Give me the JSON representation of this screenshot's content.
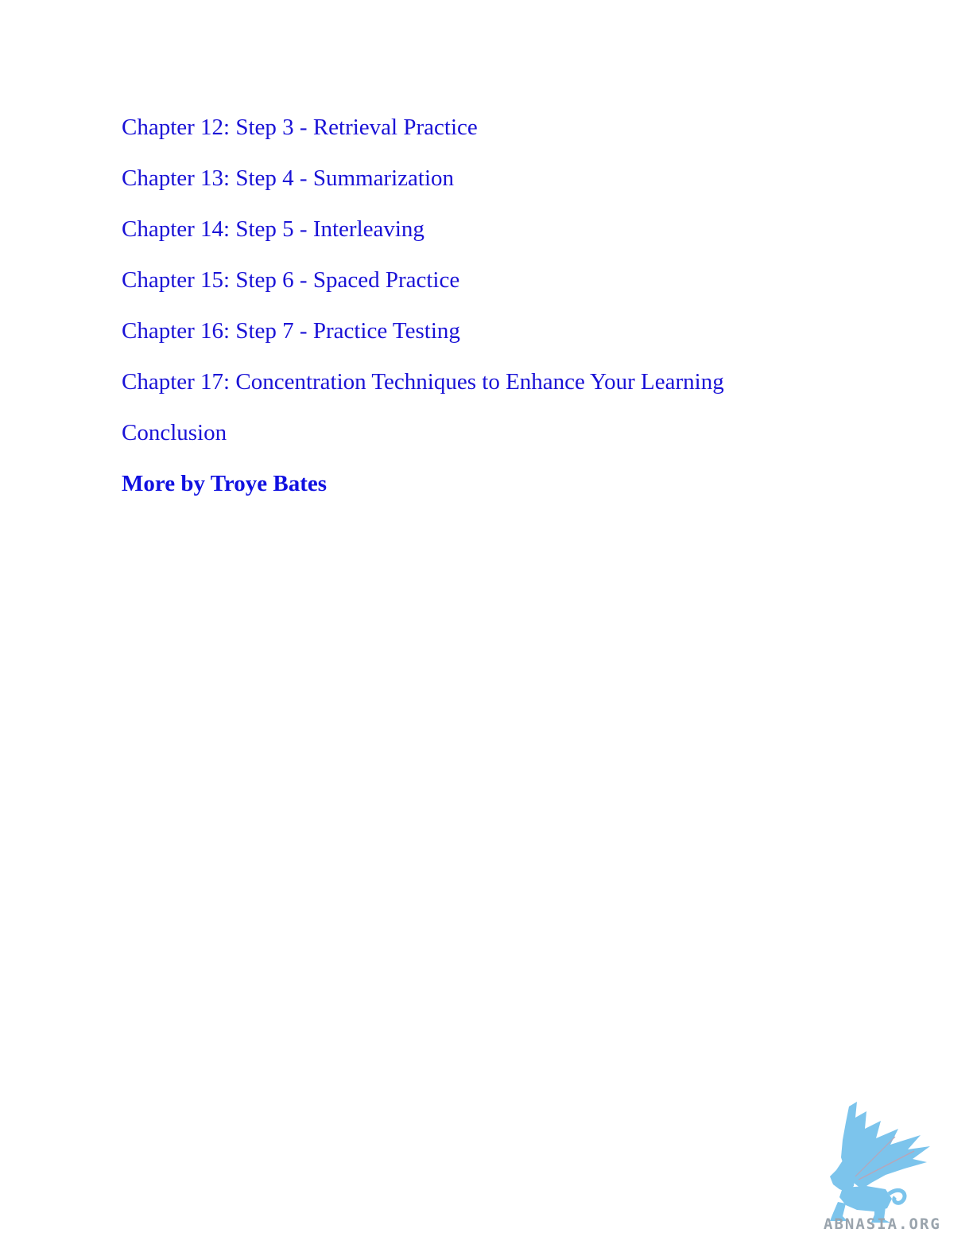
{
  "toc": {
    "items": [
      {
        "label": "Chapter 12: Step 3 - Retrieval Practice"
      },
      {
        "label": "Chapter 13: Step 4 - Summarization"
      },
      {
        "label": "Chapter 14: Step 5 - Interleaving"
      },
      {
        "label": "Chapter 15: Step 6 - Spaced Practice"
      },
      {
        "label": "Chapter 16: Step 7 - Practice Testing"
      },
      {
        "label": "Chapter 17: Concentration Techniques to Enhance Your Learning"
      },
      {
        "label": "Conclusion"
      },
      {
        "label": "More by Troye Bates"
      }
    ],
    "link_color": "#1a12d6"
  },
  "watermark": {
    "text": "ABNASIA.ORG",
    "icon": "griffin-logo-icon",
    "color": "#7cc4ec"
  }
}
